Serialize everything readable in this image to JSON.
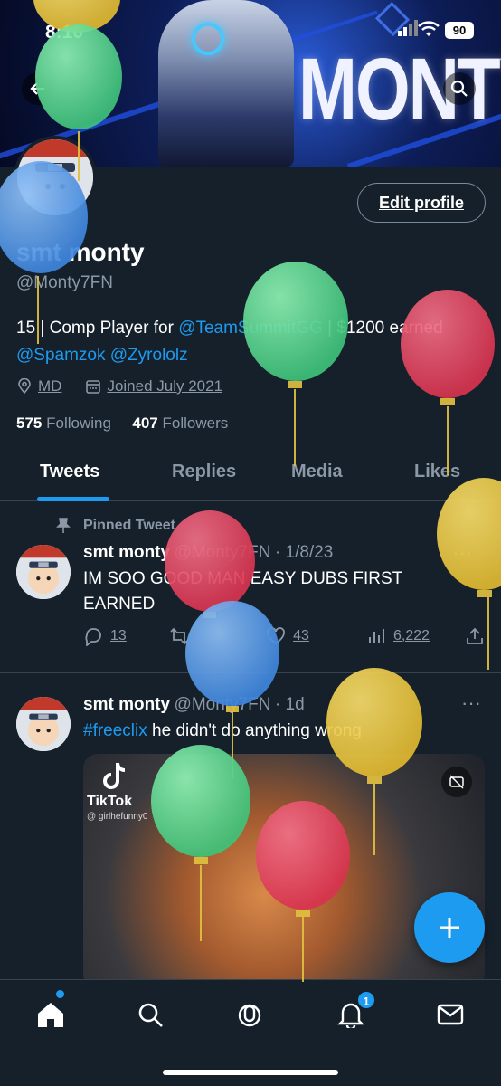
{
  "status_bar": {
    "time": "8:10",
    "battery": "90"
  },
  "banner": {
    "brand_text": "MONTY"
  },
  "profile": {
    "name": "smt monty",
    "handle": "@Monty7FN",
    "edit_label": "Edit profile",
    "bio_line1_a": "15 | Comp Player for ",
    "bio_line1_link": "@TeamSummitGG",
    "bio_line1_b": " | $1200 earned",
    "bio_line2_link1": "@Spamzok",
    "bio_line2_link2": "@Zyrololz",
    "location": "MD",
    "joined": "Joined July 2021",
    "following_count": "575",
    "following_label": "Following",
    "followers_count": "407",
    "followers_label": "Followers"
  },
  "tabs": [
    {
      "label": "Tweets"
    },
    {
      "label": "Replies"
    },
    {
      "label": "Media"
    },
    {
      "label": "Likes"
    }
  ],
  "tweets": [
    {
      "pinned_label": "Pinned Tweet",
      "name": "smt monty",
      "handle": "@Monty7FN",
      "date": "· 1/8/23",
      "text": "IM SOO GOOD MAN EASY DUBS FIRST EARNED",
      "replies": "13",
      "likes": "43",
      "views": "6,222"
    },
    {
      "name": "smt monty",
      "handle": "@Monty7FN",
      "date": "· 1d",
      "hashtag": "#freeclix",
      "text": " he didn't do anything wrong",
      "media_brand": "TikTok",
      "media_user": "@ girlhefunny0"
    }
  ],
  "nav": {
    "notifications_badge": "1"
  },
  "colors": {
    "accent": "#1d9bf0",
    "background": "#15202b",
    "muted": "#8b98a5"
  },
  "icons": [
    "back-arrow-icon",
    "search-icon",
    "location-pin-icon",
    "calendar-icon",
    "pin-icon",
    "reply-icon",
    "retweet-icon",
    "like-icon",
    "views-icon",
    "share-icon",
    "more-icon",
    "compose-plus-icon",
    "home-icon",
    "spaces-icon",
    "bell-icon",
    "mail-icon"
  ]
}
